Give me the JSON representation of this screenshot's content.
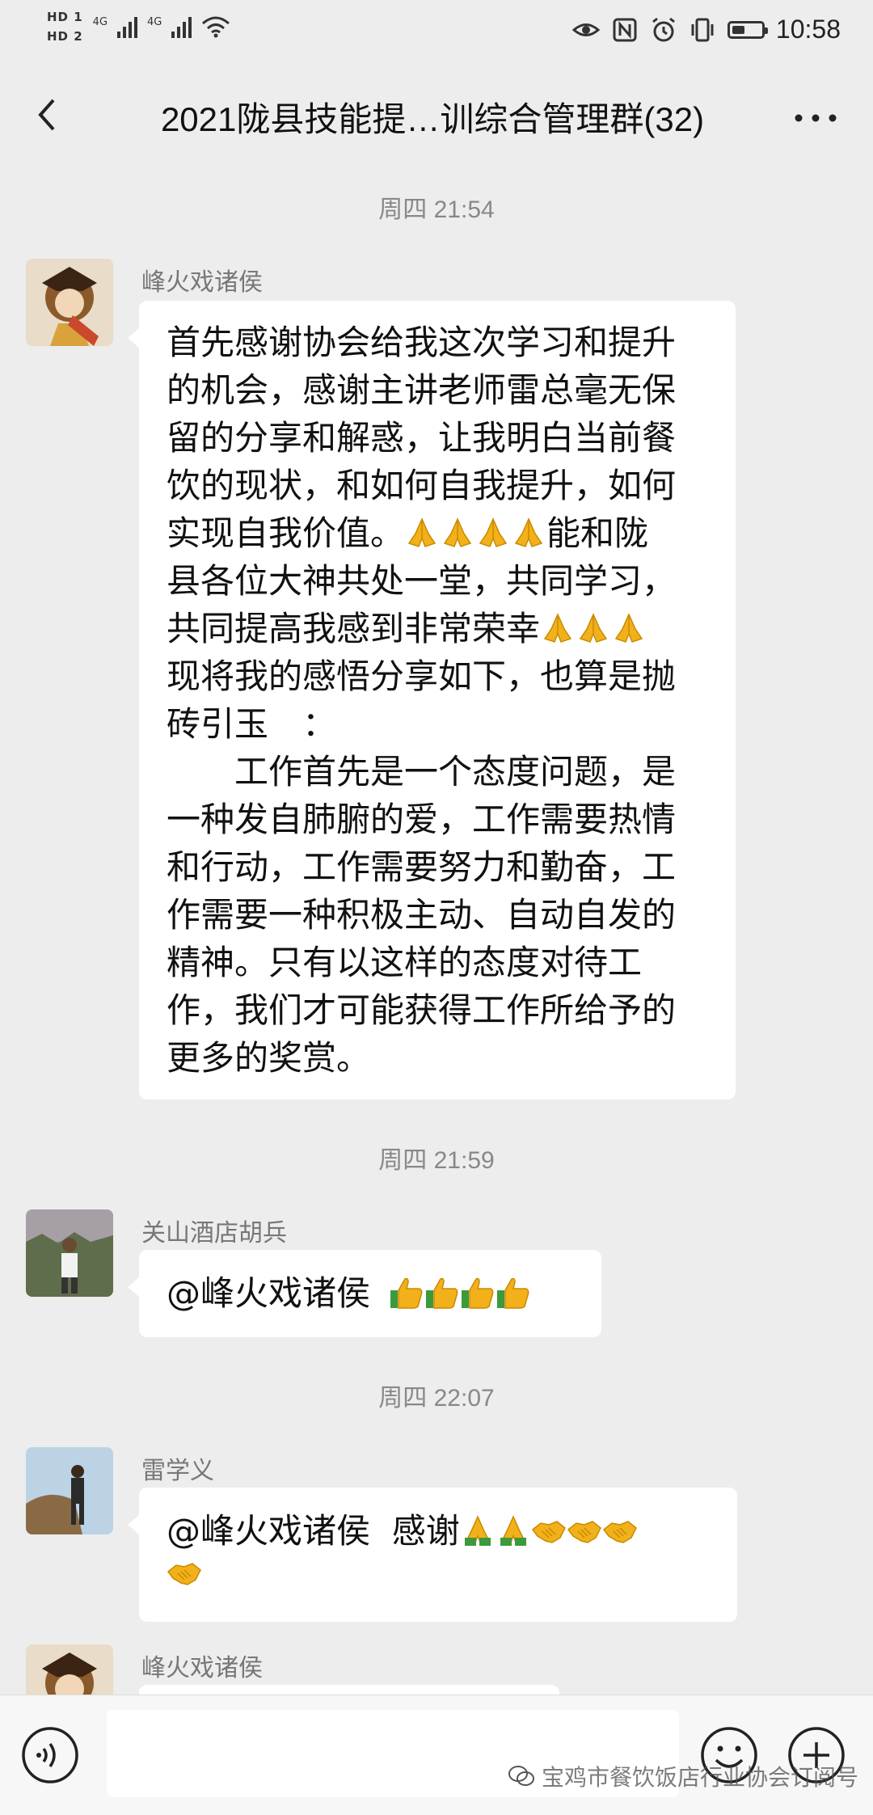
{
  "status_bar": {
    "sim1": "HD 1",
    "sim2": "HD 2",
    "net1": "4G",
    "net2": "4G",
    "time": "10:58",
    "battery_level": 0.45,
    "icons": [
      "eye-icon",
      "nfc-icon",
      "alarm-icon",
      "vibrate-icon",
      "battery-icon"
    ]
  },
  "header": {
    "title": "2021陇县技能提…训综合管理群(32)",
    "back_icon": "back-chevron-icon",
    "more_icon": "more-dots-icon"
  },
  "messages": [
    {
      "timestamp": "周四 21:54",
      "sender": "峰火戏诸侯",
      "text_lines": [
        "首先感谢协会给我这次学习和提升",
        "的机会，感谢主讲老师雷总毫无保",
        "留的分享和解惑，让我明白当前餐",
        "饮的现状，和如何自我提升，如何",
        "实现自我价值。",
        "能和陇",
        "县各位大神共处一堂，共同学习，",
        "共同提高我感到非常荣幸",
        "现将我的感悟分享如下，也算是抛",
        "砖引玉　：",
        "　　工作首先是一个态度问题，是",
        "一种发自肺腑的爱，工作需要热情",
        "和行动，工作需要努力和勤奋，工",
        "作需要一种积极主动、自动自发的",
        "精神。只有以这样的态度对待工",
        "作，我们才可能获得工作所给予的",
        "更多的奖赏。"
      ]
    },
    {
      "timestamp": "周四 21:59",
      "sender": "关山酒店胡兵",
      "text": "@峰火戏诸侯"
    },
    {
      "timestamp": "周四 22:07",
      "sender": "雷学义",
      "text": "@峰火戏诸侯  感谢"
    },
    {
      "sender": "峰火戏诸侯"
    }
  ],
  "input_bar": {
    "voice_icon": "voice-icon",
    "emoji_icon": "emoji-icon",
    "plus_icon": "plus-icon"
  },
  "watermark": "宝鸡市餐饮饭店行业协会订阅号",
  "colors": {
    "background": "#ededed",
    "bubble": "#ffffff",
    "timestamp": "#888888",
    "sender": "#777777",
    "emoji_yellow": "#f2b11a",
    "emoji_green": "#3c9a3c"
  }
}
